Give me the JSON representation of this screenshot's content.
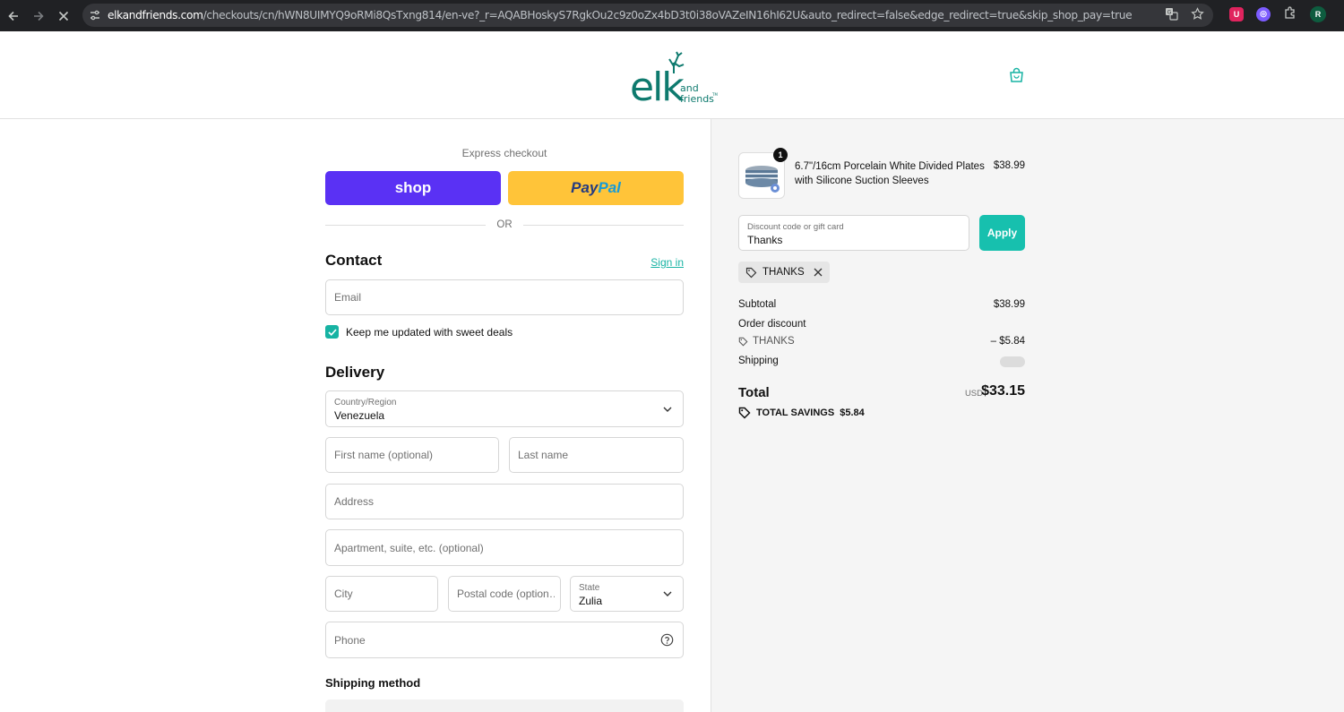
{
  "browser": {
    "url_host": "elkandfriends.com",
    "url_rest": "/checkouts/cn/hWN8UIMYQ9oRMi8QsTxng814/en-ve?_r=AQABHoskyS7RgkOu2c9z0oZx4bD3t0i38oVAZeIN16hI62U&auto_redirect=false&edge_redirect=true&skip_shop_pay=true",
    "profile_initial": "R"
  },
  "header": {
    "logo_main": "elk",
    "logo_sub_1": "and",
    "logo_sub_2": "friends"
  },
  "express": {
    "label": "Express checkout",
    "shop_label": "shop",
    "paypal_pay": "Pay",
    "paypal_pal": "Pal",
    "or_label": "OR"
  },
  "contact": {
    "heading": "Contact",
    "sign_in": "Sign in",
    "email_placeholder": "Email",
    "newsletter_label": "Keep me updated with sweet deals",
    "newsletter_checked": true
  },
  "delivery": {
    "heading": "Delivery",
    "country_label": "Country/Region",
    "country_value": "Venezuela",
    "first_name_placeholder": "First name (optional)",
    "last_name_placeholder": "Last name",
    "address_placeholder": "Address",
    "apartment_placeholder": "Apartment, suite, etc. (optional)",
    "city_placeholder": "City",
    "postal_placeholder": "Postal code (option…",
    "state_label": "State",
    "state_value": "Zulia",
    "phone_placeholder": "Phone"
  },
  "shipping_method": {
    "heading": "Shipping method"
  },
  "summary": {
    "item": {
      "quantity": "1",
      "name": "6.7\"/16cm Porcelain White Divided Plates with Silicone Suction Sleeves",
      "price": "$38.99"
    },
    "discount": {
      "label": "Discount code or gift card",
      "value": "Thanks",
      "apply_label": "Apply",
      "applied_code": "THANKS"
    },
    "subtotal_label": "Subtotal",
    "subtotal_value": "$38.99",
    "order_discount_label": "Order discount",
    "discount_code": "THANKS",
    "discount_value": "– $5.84",
    "shipping_label": "Shipping",
    "total_label": "Total",
    "currency": "USD",
    "total_value": "$33.15",
    "savings_label": "TOTAL SAVINGS",
    "savings_value": "$5.84"
  },
  "colors": {
    "brand_teal": "#17b3a3",
    "shop_purple": "#5a31f4",
    "paypal_yellow": "#ffc439"
  }
}
